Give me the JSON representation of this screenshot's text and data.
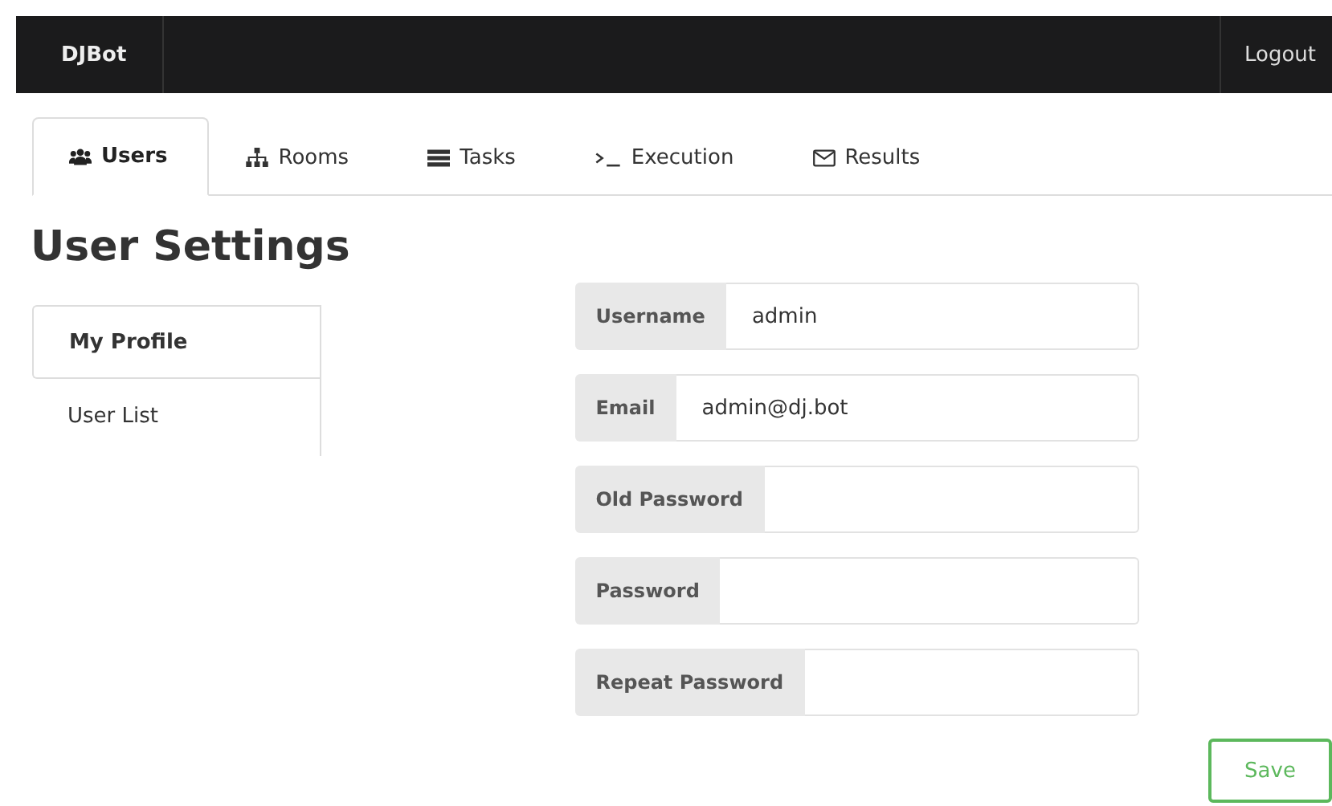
{
  "navbar": {
    "brand": "DJBot",
    "logout": "Logout"
  },
  "tabs": [
    {
      "label": "Users",
      "selected": true
    },
    {
      "label": "Rooms",
      "selected": false
    },
    {
      "label": "Tasks",
      "selected": false
    },
    {
      "label": "Execution",
      "selected": false
    },
    {
      "label": "Results",
      "selected": false
    }
  ],
  "heading": "User Settings",
  "sidebar": {
    "items": [
      {
        "label": "My Profile",
        "selected": true
      },
      {
        "label": "User List",
        "selected": false
      }
    ]
  },
  "form": {
    "fields": [
      {
        "label": "Username",
        "value": "admin"
      },
      {
        "label": "Email",
        "value": "admin@dj.bot"
      },
      {
        "label": "Old Password"
      },
      {
        "label": "Password"
      },
      {
        "label": "Repeat Password"
      }
    ]
  },
  "save_button": "Save"
}
